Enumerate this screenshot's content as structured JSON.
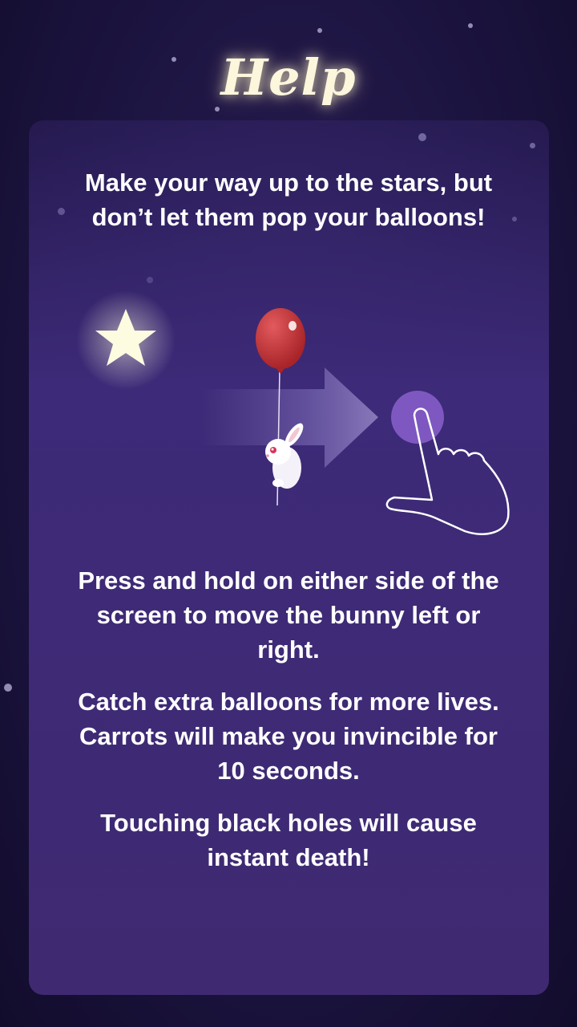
{
  "title": "Help",
  "intro": "Make your way up to the stars, but don’t let them pop your balloons!",
  "instructions": [
    "Press and hold on either side of the screen to move the bunny left or right.",
    "Catch extra balloons for more lives. Carrots will make you invincible for 10 seconds.",
    "Touching black holes will cause instant death!"
  ],
  "colors": {
    "background": "#1c1440",
    "panel": "#3d2a78",
    "star": "#fdfbe0",
    "balloon": "#c8373c",
    "touch": "#7e58c0"
  },
  "icons": [
    "star-icon",
    "balloon-icon",
    "bunny-icon",
    "arrow-right-icon",
    "hand-tap-icon"
  ]
}
